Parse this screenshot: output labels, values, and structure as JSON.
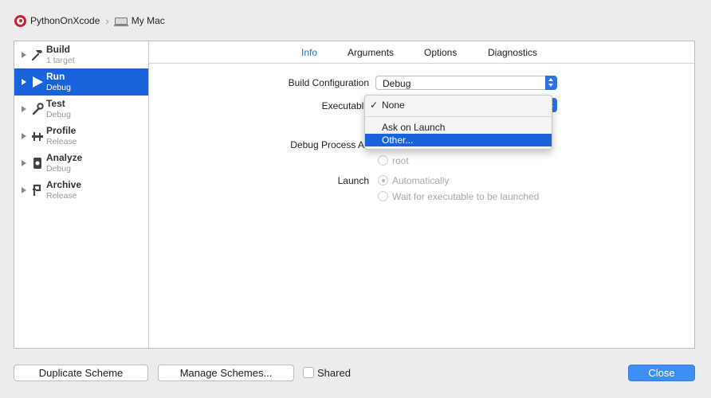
{
  "breadcrumb": {
    "project": "PythonOnXcode",
    "destination": "My Mac"
  },
  "sidebar": {
    "items": [
      {
        "title": "Build",
        "subtitle": "1 target",
        "icon": "hammer-icon"
      },
      {
        "title": "Run",
        "subtitle": "Debug",
        "icon": "play-icon",
        "selected": true
      },
      {
        "title": "Test",
        "subtitle": "Debug",
        "icon": "wrench-icon"
      },
      {
        "title": "Profile",
        "subtitle": "Release",
        "icon": "gauge-icon"
      },
      {
        "title": "Analyze",
        "subtitle": "Debug",
        "icon": "analyze-icon"
      },
      {
        "title": "Archive",
        "subtitle": "Release",
        "icon": "archive-icon"
      }
    ]
  },
  "tabs": [
    "Info",
    "Arguments",
    "Options",
    "Diagnostics"
  ],
  "form": {
    "build_configuration_label": "Build Configuration",
    "build_configuration_value": "Debug",
    "executable_label": "Executable",
    "debug_process_label": "Debug Process As",
    "debug_process_option_root": "root",
    "launch_label": "Launch",
    "launch_option_auto": "Automatically",
    "launch_option_wait": "Wait for executable to be launched"
  },
  "executable_menu": {
    "items": [
      "None",
      "Ask on Launch",
      "Other..."
    ],
    "checked": "None",
    "highlighted": "Other..."
  },
  "footer": {
    "duplicate_label": "Duplicate Scheme",
    "manage_label": "Manage Schemes...",
    "shared_label": "Shared",
    "close_label": "Close"
  },
  "colors": {
    "selection": "#1863d9",
    "accent": "#2a73d6",
    "primary_button": "#3d8ff5",
    "target_icon": "#c8232c"
  }
}
